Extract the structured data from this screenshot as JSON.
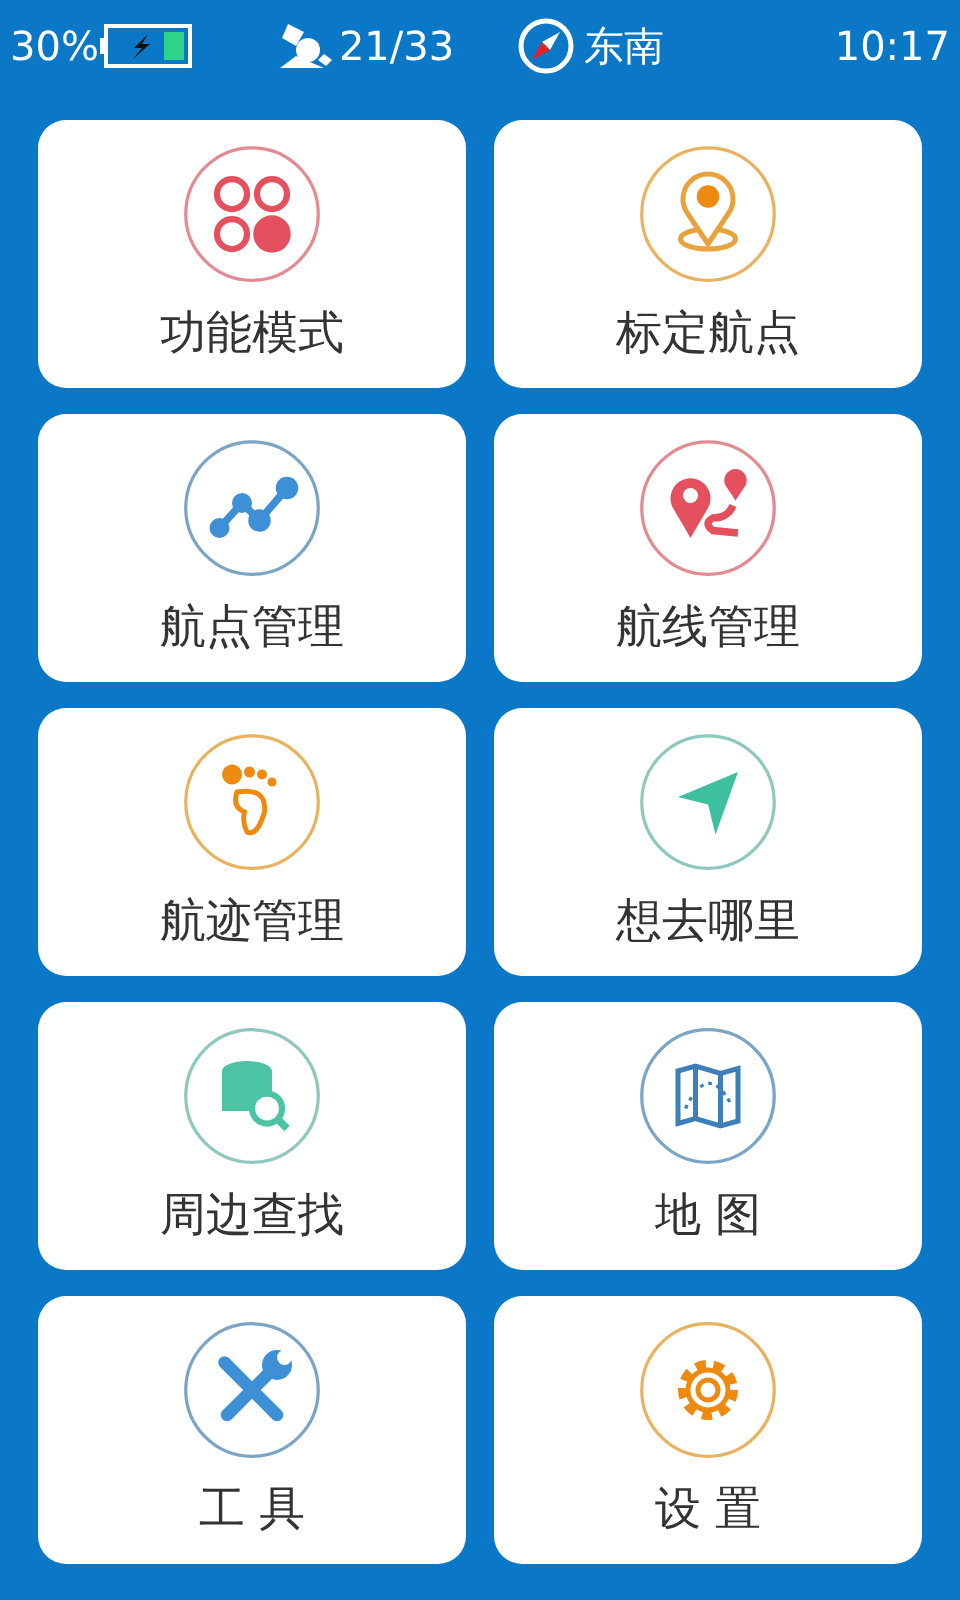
{
  "status_bar": {
    "battery": "30%",
    "satellites": "21/33",
    "heading": "东南",
    "time": "10:17"
  },
  "tiles": [
    {
      "label": "功能模式",
      "kind": "modes"
    },
    {
      "label": "标定航点",
      "kind": "pin"
    },
    {
      "label": "航点管理",
      "kind": "waypoints"
    },
    {
      "label": "航线管理",
      "kind": "route"
    },
    {
      "label": "航迹管理",
      "kind": "foot"
    },
    {
      "label": "想去哪里",
      "kind": "navigate"
    },
    {
      "label": "周边查找",
      "kind": "search"
    },
    {
      "label": "地 图",
      "kind": "map"
    },
    {
      "label": "工 具",
      "kind": "tools"
    },
    {
      "label": "设 置",
      "kind": "settings"
    }
  ]
}
